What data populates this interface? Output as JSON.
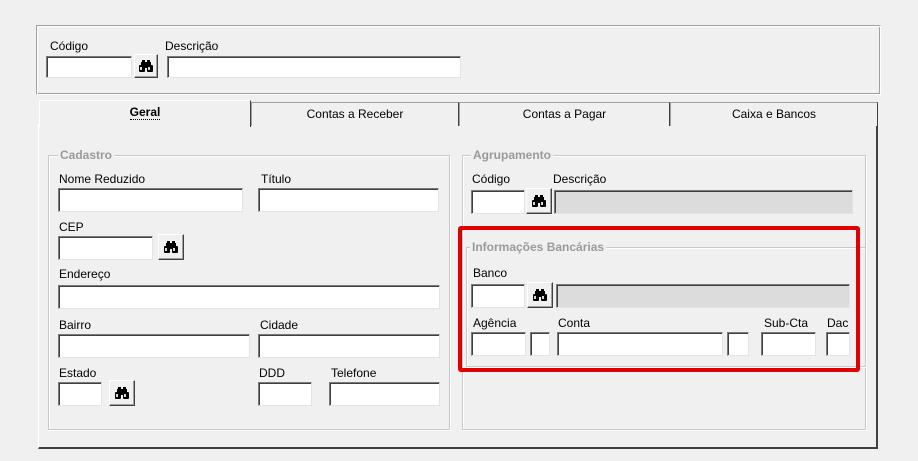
{
  "header": {
    "codigo_label": "Código",
    "descricao_label": "Descrição",
    "codigo_value": "",
    "descricao_value": ""
  },
  "tabs": [
    {
      "label": "Geral",
      "active": true
    },
    {
      "label": "Contas a Receber",
      "active": false
    },
    {
      "label": "Contas a Pagar",
      "active": false
    },
    {
      "label": "Caixa e Bancos",
      "active": false
    }
  ],
  "cadastro": {
    "title": "Cadastro",
    "nome_reduzido_label": "Nome Reduzido",
    "titulo_label": "Título",
    "cep_label": "CEP",
    "endereco_label": "Endereço",
    "bairro_label": "Bairro",
    "cidade_label": "Cidade",
    "estado_label": "Estado",
    "ddd_label": "DDD",
    "telefone_label": "Telefone"
  },
  "agrupamento": {
    "title": "Agrupamento",
    "codigo_label": "Código",
    "descricao_label": "Descrição"
  },
  "bancarias": {
    "title": "Informações Bancárias",
    "banco_label": "Banco",
    "agencia_label": "Agência",
    "conta_label": "Conta",
    "subcta_label": "Sub-Cta",
    "dac_label": "Dac"
  },
  "icons": {
    "lookup": "binoculars-icon"
  },
  "colors": {
    "highlight": "#e00000",
    "background": "#f0f0f0"
  }
}
